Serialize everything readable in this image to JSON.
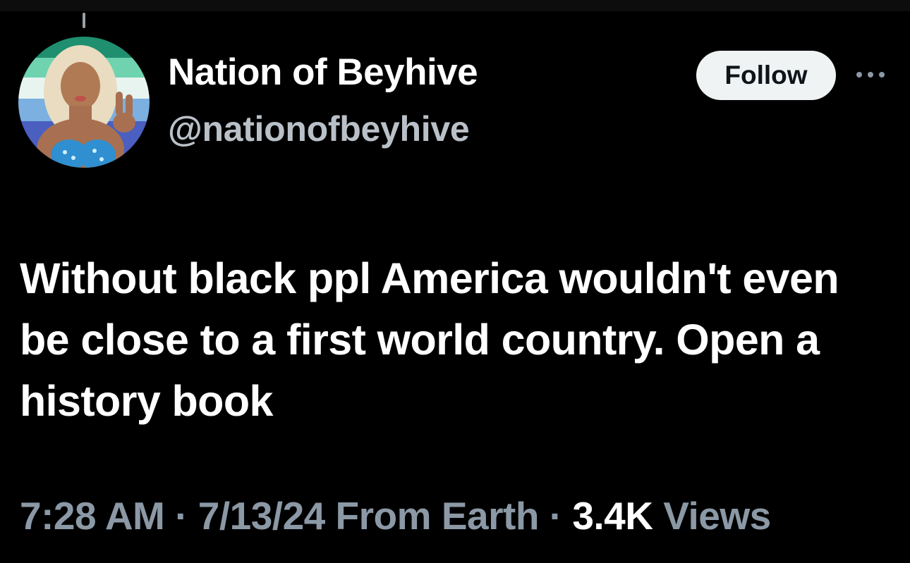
{
  "author": {
    "display_name": "Nation of Beyhive",
    "handle": "@nationofbeyhive",
    "avatar_icon": "profile-photo-avatar"
  },
  "actions": {
    "follow_label": "Follow",
    "more_icon": "more-horizontal-icon"
  },
  "tweet": {
    "text": "Without black ppl America wouldn't even be close to a first world country. Open a history book"
  },
  "meta": {
    "time": "7:28 AM",
    "sep1": " · ",
    "date": "7/13/24",
    "location": " From Earth",
    "sep2": " · ",
    "views_count": "3.4K",
    "views_label": " Views"
  },
  "colors": {
    "background": "#000000",
    "primary_text": "#ffffff",
    "secondary_text": "#8b98a5",
    "follow_button_bg": "#eff3f4"
  }
}
